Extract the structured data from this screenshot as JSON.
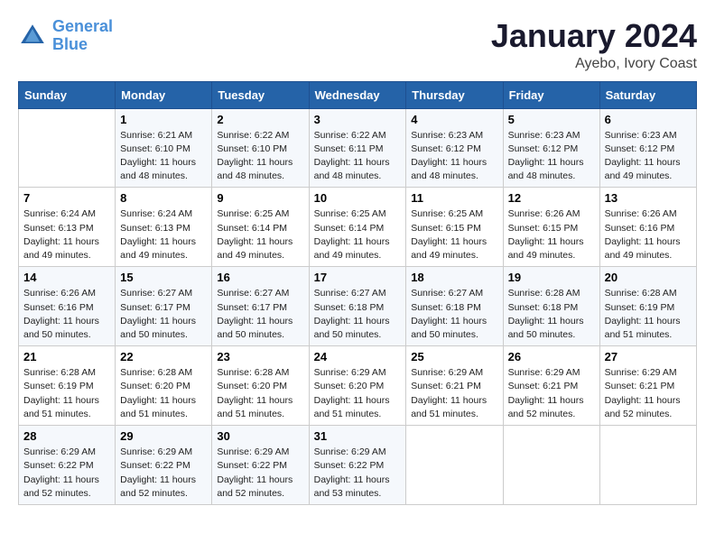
{
  "logo": {
    "text_general": "General",
    "text_blue": "Blue"
  },
  "title": "January 2024",
  "subtitle": "Ayebo, Ivory Coast",
  "days_of_week": [
    "Sunday",
    "Monday",
    "Tuesday",
    "Wednesday",
    "Thursday",
    "Friday",
    "Saturday"
  ],
  "weeks": [
    [
      {
        "day": "",
        "info": ""
      },
      {
        "day": "1",
        "info": "Sunrise: 6:21 AM\nSunset: 6:10 PM\nDaylight: 11 hours\nand 48 minutes."
      },
      {
        "day": "2",
        "info": "Sunrise: 6:22 AM\nSunset: 6:10 PM\nDaylight: 11 hours\nand 48 minutes."
      },
      {
        "day": "3",
        "info": "Sunrise: 6:22 AM\nSunset: 6:11 PM\nDaylight: 11 hours\nand 48 minutes."
      },
      {
        "day": "4",
        "info": "Sunrise: 6:23 AM\nSunset: 6:12 PM\nDaylight: 11 hours\nand 48 minutes."
      },
      {
        "day": "5",
        "info": "Sunrise: 6:23 AM\nSunset: 6:12 PM\nDaylight: 11 hours\nand 48 minutes."
      },
      {
        "day": "6",
        "info": "Sunrise: 6:23 AM\nSunset: 6:12 PM\nDaylight: 11 hours\nand 49 minutes."
      }
    ],
    [
      {
        "day": "7",
        "info": "Sunrise: 6:24 AM\nSunset: 6:13 PM\nDaylight: 11 hours\nand 49 minutes."
      },
      {
        "day": "8",
        "info": "Sunrise: 6:24 AM\nSunset: 6:13 PM\nDaylight: 11 hours\nand 49 minutes."
      },
      {
        "day": "9",
        "info": "Sunrise: 6:25 AM\nSunset: 6:14 PM\nDaylight: 11 hours\nand 49 minutes."
      },
      {
        "day": "10",
        "info": "Sunrise: 6:25 AM\nSunset: 6:14 PM\nDaylight: 11 hours\nand 49 minutes."
      },
      {
        "day": "11",
        "info": "Sunrise: 6:25 AM\nSunset: 6:15 PM\nDaylight: 11 hours\nand 49 minutes."
      },
      {
        "day": "12",
        "info": "Sunrise: 6:26 AM\nSunset: 6:15 PM\nDaylight: 11 hours\nand 49 minutes."
      },
      {
        "day": "13",
        "info": "Sunrise: 6:26 AM\nSunset: 6:16 PM\nDaylight: 11 hours\nand 49 minutes."
      }
    ],
    [
      {
        "day": "14",
        "info": "Sunrise: 6:26 AM\nSunset: 6:16 PM\nDaylight: 11 hours\nand 50 minutes."
      },
      {
        "day": "15",
        "info": "Sunrise: 6:27 AM\nSunset: 6:17 PM\nDaylight: 11 hours\nand 50 minutes."
      },
      {
        "day": "16",
        "info": "Sunrise: 6:27 AM\nSunset: 6:17 PM\nDaylight: 11 hours\nand 50 minutes."
      },
      {
        "day": "17",
        "info": "Sunrise: 6:27 AM\nSunset: 6:18 PM\nDaylight: 11 hours\nand 50 minutes."
      },
      {
        "day": "18",
        "info": "Sunrise: 6:27 AM\nSunset: 6:18 PM\nDaylight: 11 hours\nand 50 minutes."
      },
      {
        "day": "19",
        "info": "Sunrise: 6:28 AM\nSunset: 6:18 PM\nDaylight: 11 hours\nand 50 minutes."
      },
      {
        "day": "20",
        "info": "Sunrise: 6:28 AM\nSunset: 6:19 PM\nDaylight: 11 hours\nand 51 minutes."
      }
    ],
    [
      {
        "day": "21",
        "info": "Sunrise: 6:28 AM\nSunset: 6:19 PM\nDaylight: 11 hours\nand 51 minutes."
      },
      {
        "day": "22",
        "info": "Sunrise: 6:28 AM\nSunset: 6:20 PM\nDaylight: 11 hours\nand 51 minutes."
      },
      {
        "day": "23",
        "info": "Sunrise: 6:28 AM\nSunset: 6:20 PM\nDaylight: 11 hours\nand 51 minutes."
      },
      {
        "day": "24",
        "info": "Sunrise: 6:29 AM\nSunset: 6:20 PM\nDaylight: 11 hours\nand 51 minutes."
      },
      {
        "day": "25",
        "info": "Sunrise: 6:29 AM\nSunset: 6:21 PM\nDaylight: 11 hours\nand 51 minutes."
      },
      {
        "day": "26",
        "info": "Sunrise: 6:29 AM\nSunset: 6:21 PM\nDaylight: 11 hours\nand 52 minutes."
      },
      {
        "day": "27",
        "info": "Sunrise: 6:29 AM\nSunset: 6:21 PM\nDaylight: 11 hours\nand 52 minutes."
      }
    ],
    [
      {
        "day": "28",
        "info": "Sunrise: 6:29 AM\nSunset: 6:22 PM\nDaylight: 11 hours\nand 52 minutes."
      },
      {
        "day": "29",
        "info": "Sunrise: 6:29 AM\nSunset: 6:22 PM\nDaylight: 11 hours\nand 52 minutes."
      },
      {
        "day": "30",
        "info": "Sunrise: 6:29 AM\nSunset: 6:22 PM\nDaylight: 11 hours\nand 52 minutes."
      },
      {
        "day": "31",
        "info": "Sunrise: 6:29 AM\nSunset: 6:22 PM\nDaylight: 11 hours\nand 53 minutes."
      },
      {
        "day": "",
        "info": ""
      },
      {
        "day": "",
        "info": ""
      },
      {
        "day": "",
        "info": ""
      }
    ]
  ]
}
